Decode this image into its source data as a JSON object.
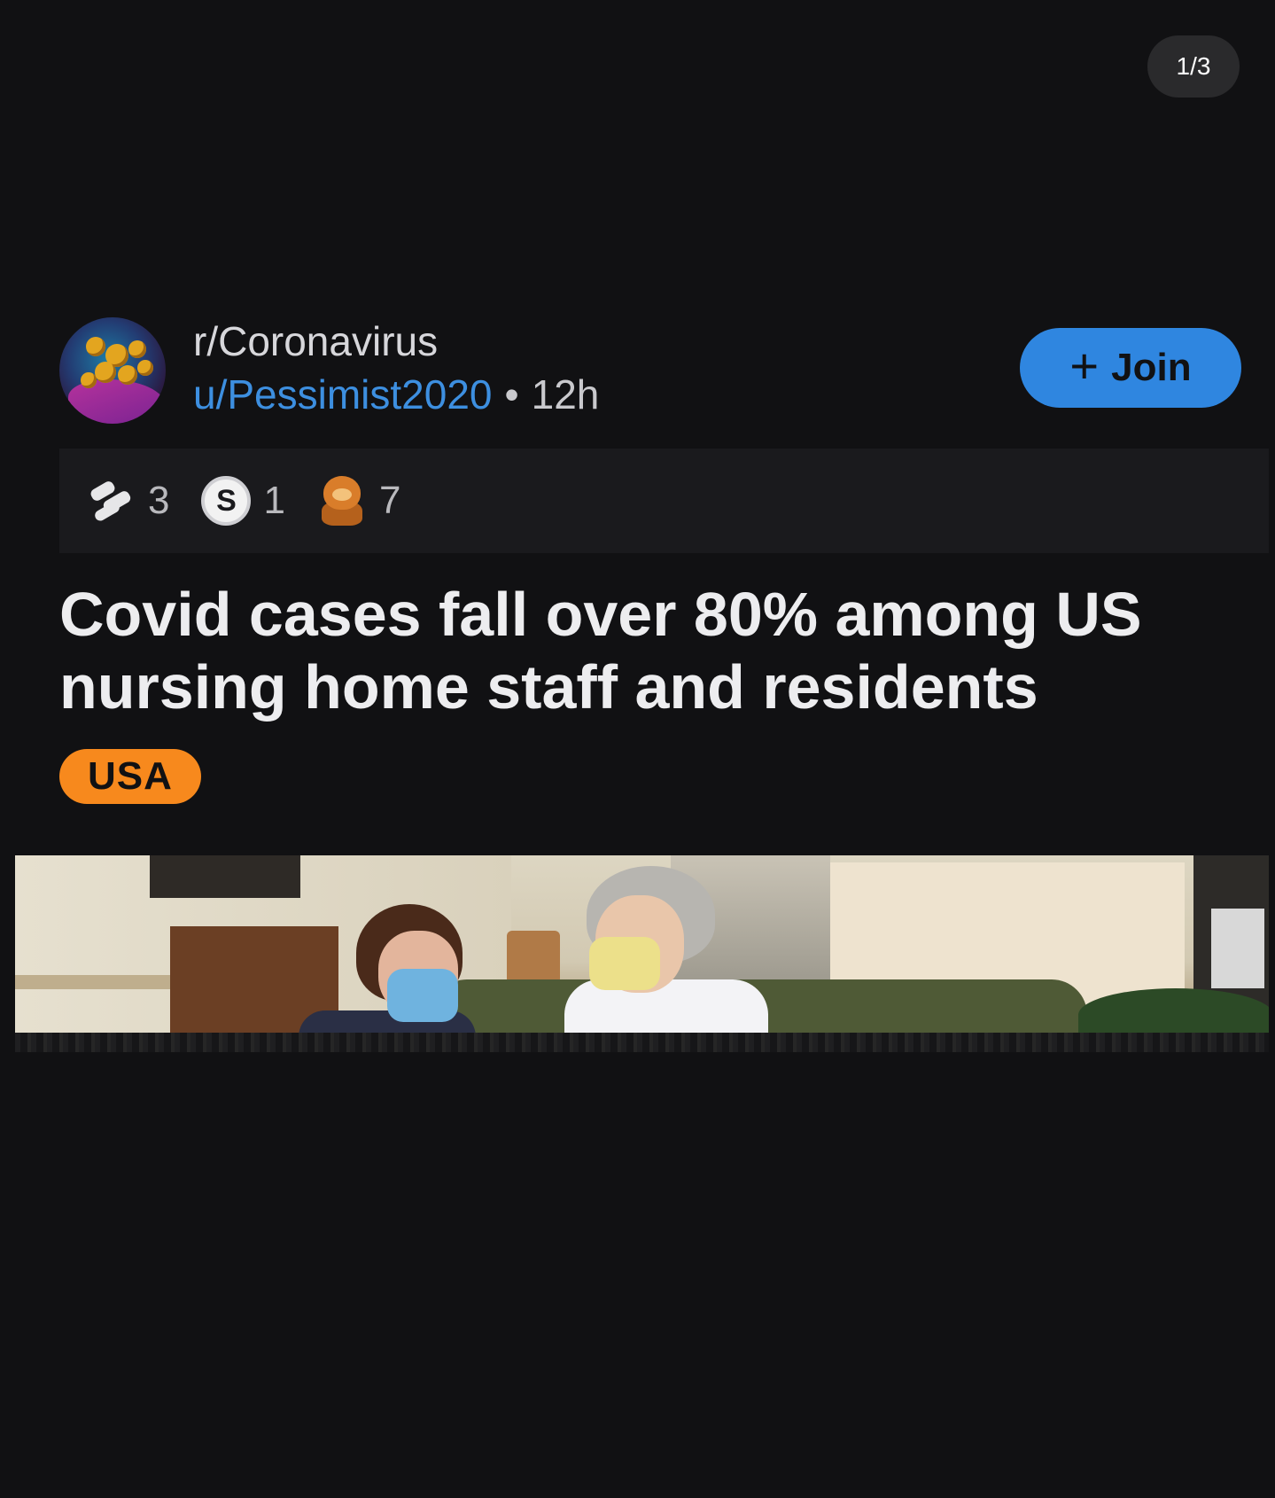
{
  "pager": {
    "label": "1/3"
  },
  "post": {
    "subreddit": "r/Coronavirus",
    "author": "u/Pessimist2020",
    "separator": "•",
    "age": "12h",
    "join_button": {
      "icon": "plus-icon",
      "label": "Join"
    },
    "awards": [
      {
        "icon": "hands-award-icon",
        "count": "3"
      },
      {
        "icon": "silver-s-award-icon",
        "count": "1"
      },
      {
        "icon": "bear-award-icon",
        "count": "7"
      }
    ],
    "title": "Covid cases fall over 80% among US nursing home staff and residents",
    "flair": "USA"
  },
  "colors": {
    "background": "#111113",
    "join_button": "#2f86e0",
    "username": "#3d8fe0",
    "flair": "#f7891d"
  }
}
